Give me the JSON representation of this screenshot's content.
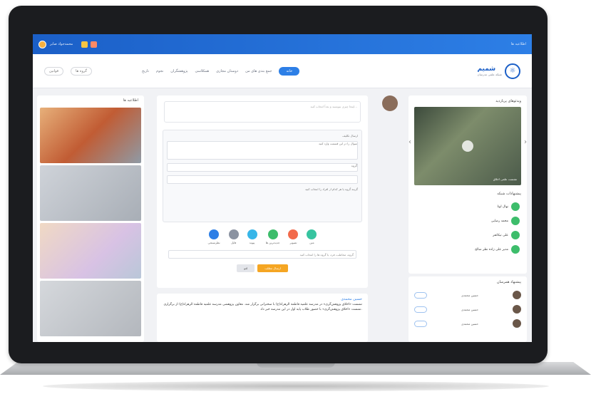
{
  "topbar": {
    "username": "محمدجواد صابر",
    "right_text": "اطلاعیه ها"
  },
  "brand": {
    "name": "شمیم",
    "subtitle": "شبکه علمی مدرسان"
  },
  "nav": {
    "items": [
      "خانه",
      "جمع بندی های من",
      "دوستان مجازی",
      "همکلاسی",
      "پژوهشگران",
      "نجوم",
      "تاریخ"
    ]
  },
  "header_actions": {
    "rules": "قوانین",
    "groups": "گروه ها"
  },
  "left": {
    "title": "اطلاعیه ها"
  },
  "composer": {
    "placeholder": "اینجا چیزی بنویسید و بعداً انتخاب کنید..."
  },
  "share": {
    "label": "ارسال تکلیف",
    "field_placeholder": "سوال را در این قسمت وارد کنید",
    "group_label": "گروه",
    "note": "گزینه گروه یا هر کدام از افراد را انتخاب کنید"
  },
  "icons": [
    "نظرسنجی",
    "فایل",
    "پیوند",
    "جدیدترین ها",
    "تصویر",
    "متن"
  ],
  "select": {
    "placeholder": "گروه، مخاطب، فرد، یا گروه ها را انتخاب کنید"
  },
  "buttons": {
    "cancel": "لغو",
    "submit": "ارسال مطلب"
  },
  "post": {
    "name": "حسین محمدی",
    "text": "نشست «اخلاق پژوهش‌گری» در مدرسه علمیه فاطمة الزهراء(ع) با سخنرانی برگزار شد. معاون پژوهشی مدرسه علمیه فاطمة الزهراء(ع) از برگزاری نشست «اخلاق پژوهش‌گری» با حضور طلاب پایه اول در این مدرسه خبر داد."
  },
  "right": {
    "videos_title": "ویدئوهای پربازدید",
    "video_caption": "نشست علمی اخلاق",
    "suggest_title": "پیشنهادات شبکه",
    "suggest_more": "بیشتر",
    "suggestions": [
      "نهال اوتا",
      "محمد رضایی",
      "علی نیکانفر",
      "مدیر علی زاده نظر صالح"
    ],
    "people_title": "پیشنهاد همرسان",
    "people": [
      "حسین محمدی",
      "حسین محمدی",
      "حسین محمدی"
    ]
  },
  "colors": {
    "primary": "#2d7fe6",
    "green": "#3dbd6b",
    "orange": "#f5a623"
  }
}
